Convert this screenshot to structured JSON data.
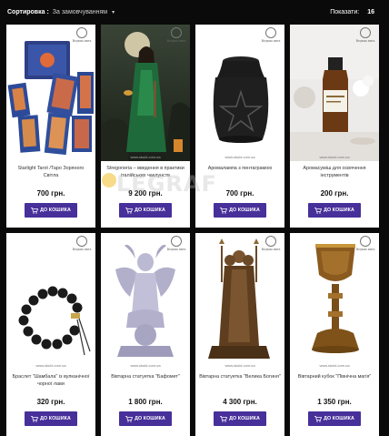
{
  "toolbar": {
    "sort_label": "Сортировка :",
    "sort_value": "За замовчуванням",
    "show_label": "Показати:",
    "show_value": "16"
  },
  "watermark": {
    "brand": "Ведьма вить",
    "overlay": "LEGRAF"
  },
  "products": [
    {
      "title": "Starlight Tarot /Таро Зоряного Світла",
      "price": "700 грн.",
      "button": "ДО КОШИКА",
      "url": ""
    },
    {
      "title": "Stregoneria – введення в практики італійських чаклунств",
      "price": "9 200 грн.",
      "button": "ДО КОШИКА",
      "url": "www.skuld.com.ua"
    },
    {
      "title": "Аромалампа з пентаграмою",
      "price": "700 грн.",
      "button": "ДО КОШИКА",
      "url": "www.skuld.com.ua"
    },
    {
      "title": "Аромасуміш для освячення інструментів",
      "price": "200 грн.",
      "button": "ДО КОШИКА",
      "url": "www.skuld.com.ua"
    },
    {
      "title": "Браслет \"Шамбала\" із вулканічної чорної лави",
      "price": "320 грн.",
      "button": "ДО КОШИКА",
      "url": "www.skuld.com.ua"
    },
    {
      "title": "Вівтарна статуетка \"Бафомет\"",
      "price": "1 800 грн.",
      "button": "ДО КОШИКА",
      "url": "www.skuld.com.ua"
    },
    {
      "title": "Вівтарна статуетка \"Велика Богиня\"",
      "price": "4 300 грн.",
      "button": "ДО КОШИКА",
      "url": "www.skuld.com.ua"
    },
    {
      "title": "Вівтарний кубок \"Північна магія\"",
      "price": "1 350 грн.",
      "button": "ДО КОШИКА",
      "url": "www.skuld.com.ua"
    }
  ]
}
